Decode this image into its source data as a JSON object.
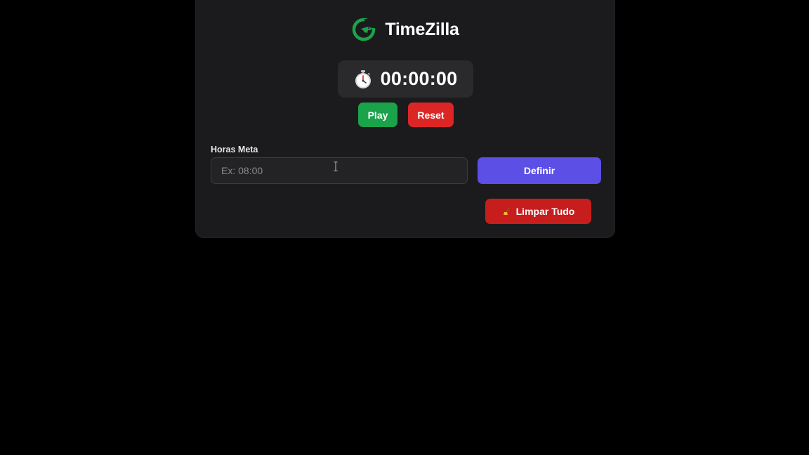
{
  "app": {
    "name": "TimeZilla",
    "logo_icon": "dinosaur-logo-icon",
    "brand_color": "#1aa34a"
  },
  "timer": {
    "icon": "stopwatch-icon",
    "value": "00:00:00"
  },
  "controls": {
    "play_label": "Play",
    "reset_label": "Reset",
    "play_color": "#1aa34a",
    "reset_color": "#dc2626"
  },
  "goal": {
    "label": "Horas Meta",
    "input_value": "",
    "placeholder": "Ex: 08:00",
    "define_label": "Definir",
    "define_color": "#5b4fe6"
  },
  "clear_all": {
    "icon": "broom-icon",
    "label": "Limpar Tudo",
    "color": "#c81d1d"
  }
}
